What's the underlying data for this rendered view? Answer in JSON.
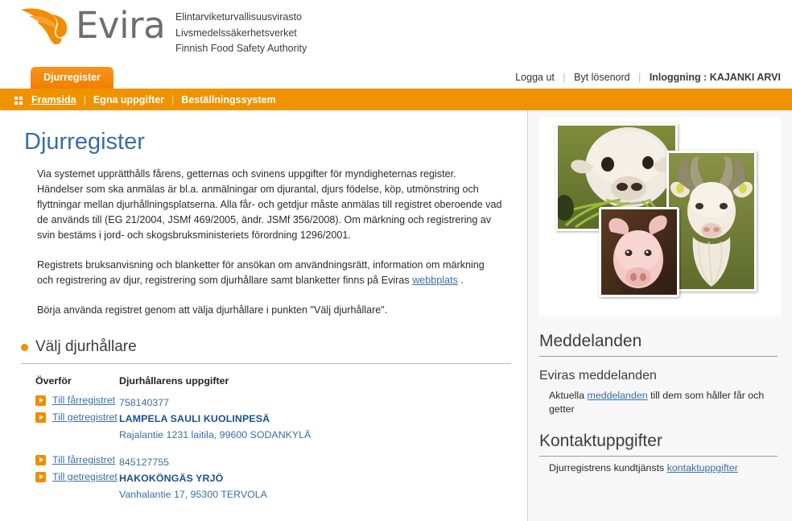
{
  "header": {
    "logo_word": "Evira",
    "logo_icon": "evira-leaf-logo",
    "org_line1": "Elintarviketurvallisuusvirasto",
    "org_line2": "Livsmedelssäkerhetsverket",
    "org_line3": "Finnish Food Safety Authority",
    "tab_label": "Djurregister",
    "logout_label": "Logga ut",
    "change_password_label": "Byt lösenord",
    "login_label": "Inloggning : KAJANKI ARVI",
    "separator": "|"
  },
  "nav": {
    "menu_icon": "grid-dots-icon",
    "items": [
      {
        "label": "Framsida",
        "active": true
      },
      {
        "label": "Egna uppgifter",
        "active": false
      },
      {
        "label": "Beställningssystem",
        "active": false
      }
    ],
    "separator": "|"
  },
  "main": {
    "title": "Djurregister",
    "paragraph1": "Via systemet upprätthålls fårens, getternas och svinens uppgifter för myndigheternas register. Händelser som ska anmälas är bl.a. anmälningar om djurantal, djurs födelse, köp, utmönstring och flyttningar mellan djurhållningsplatserna. Alla får- och getdjur måste anmälas till registret oberoende vad de används till (EG 21/2004, JSMf 469/2005, ändr. JSMf 356/2008). Om märkning och registrering av svin bestäms i jord- och skogsbruksministeriets förordning 1296/2001.",
    "paragraph2_before": "Registrets bruksanvisning och blanketter för ansökan om användningsrätt, information om märkning och registrering av djur, registrering som djurhållare samt blanketter finns på Eviras ",
    "paragraph2_link": "webbplats",
    "paragraph2_after": " .",
    "paragraph3": "Börja använda registret genom att välja djurhållare i punkten \"Välj djurhållare\".",
    "section_title": "Välj djurhållare",
    "table": {
      "columns": [
        "Överför",
        "Djurhållarens uppgifter"
      ],
      "rows": [
        {
          "links": [
            "Till fårregistret",
            "Till getregistret"
          ],
          "id": "758140377",
          "name": "LAMPELA SAULI KUOLINPESÄ",
          "address": "Rajalantie 1231 laitila, 99600 SODANKYLÄ"
        },
        {
          "links": [
            "Till fårregistret",
            "Till getregistret"
          ],
          "id": "845127755",
          "name": "HAKOKÖNGÄS YRJÖ",
          "address": "Vanhalantie 17, 95300 TERVOLA"
        }
      ]
    }
  },
  "sidebar": {
    "photo_collage_alt": "sheep-goat-pig-photo-collage",
    "messages": {
      "heading": "Meddelanden",
      "subheading": "Eviras meddelanden",
      "text_before": "Aktuella ",
      "link": "meddelanden",
      "text_after": " till dem som håller får och getter"
    },
    "contacts": {
      "heading": "Kontaktuppgifter",
      "text_before": "Djurregistrens kundtjänsts ",
      "link": "kontaktuppgifter",
      "text_after": ""
    }
  },
  "colors": {
    "brand_orange": "#f09200",
    "tab_orange": "#f7941d",
    "link_blue": "#3a6ea5",
    "title_blue": "#3a6ea5",
    "name_blue": "#1d4f91",
    "sidebar_bg": "#f7f7f7"
  }
}
